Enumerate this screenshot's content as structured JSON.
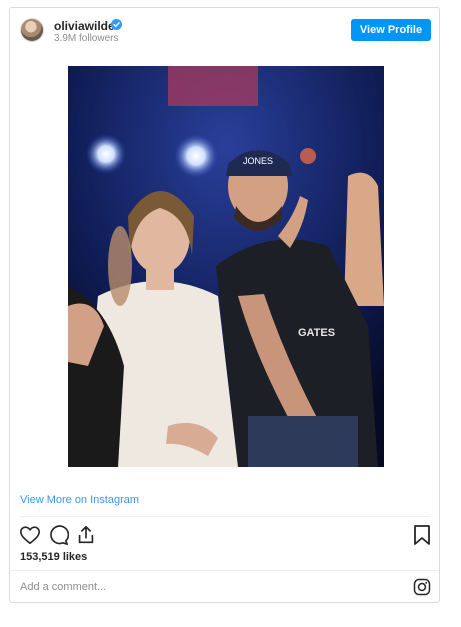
{
  "post": {
    "username": "oliviawilde",
    "followers": "3.9M followers",
    "view_profile_label": "View Profile",
    "view_more_label": "View More on Instagram",
    "likes": "153,519 likes",
    "comment_placeholder": "Add a comment..."
  },
  "photo_text": {
    "cap_text": "JONES",
    "shirt_text": "GATES"
  },
  "icons": {
    "verified": "verified-badge-icon",
    "like": "heart-icon",
    "comment": "comment-icon",
    "share": "share-icon",
    "save": "bookmark-icon",
    "instagram": "instagram-logo-icon"
  },
  "colors": {
    "accent": "#0095f6",
    "link": "#3897f0",
    "muted": "#8e8e8e"
  }
}
